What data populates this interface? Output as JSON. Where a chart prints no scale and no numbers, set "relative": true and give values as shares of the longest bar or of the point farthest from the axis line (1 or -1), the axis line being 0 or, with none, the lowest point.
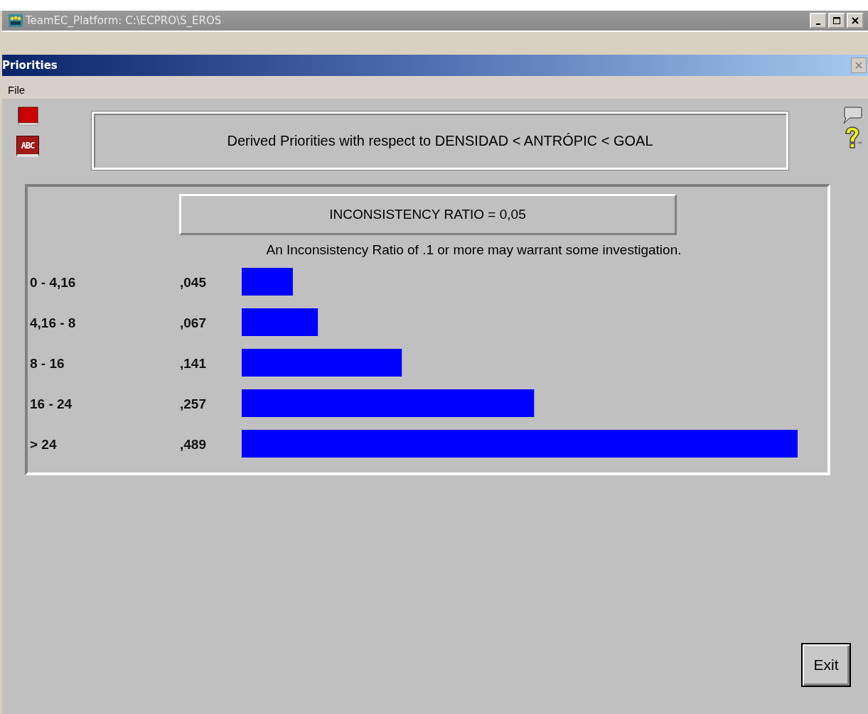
{
  "window": {
    "title": "TeamEC_Platform: C:\\ECPRO\\S_EROS"
  },
  "dialog": {
    "title": "Priorities"
  },
  "menu": [
    "File"
  ],
  "abc_icon": "ABC",
  "header": "Derived Priorities with respect to DENSIDAD < ANTRÓPIC < GOAL",
  "inconsistency": "INCONSISTENCY RATIO = 0,05",
  "note": "An Inconsistency Ratio of .1 or more may warrant some investigation.",
  "priorities": {
    "chart_data": {
      "type": "bar",
      "orientation": "horizontal",
      "categories": [
        "0 - 4,16",
        "4,16 - 8",
        "8 - 16",
        "16 - 24",
        "> 24"
      ],
      "values": [
        0.092,
        0.137,
        0.288,
        0.526,
        1.0
      ],
      "relative": true
    },
    "readings": [
      ",045",
      ",067",
      ",141",
      ",257",
      ",489"
    ]
  },
  "buttons": [
    "Exit"
  ]
}
